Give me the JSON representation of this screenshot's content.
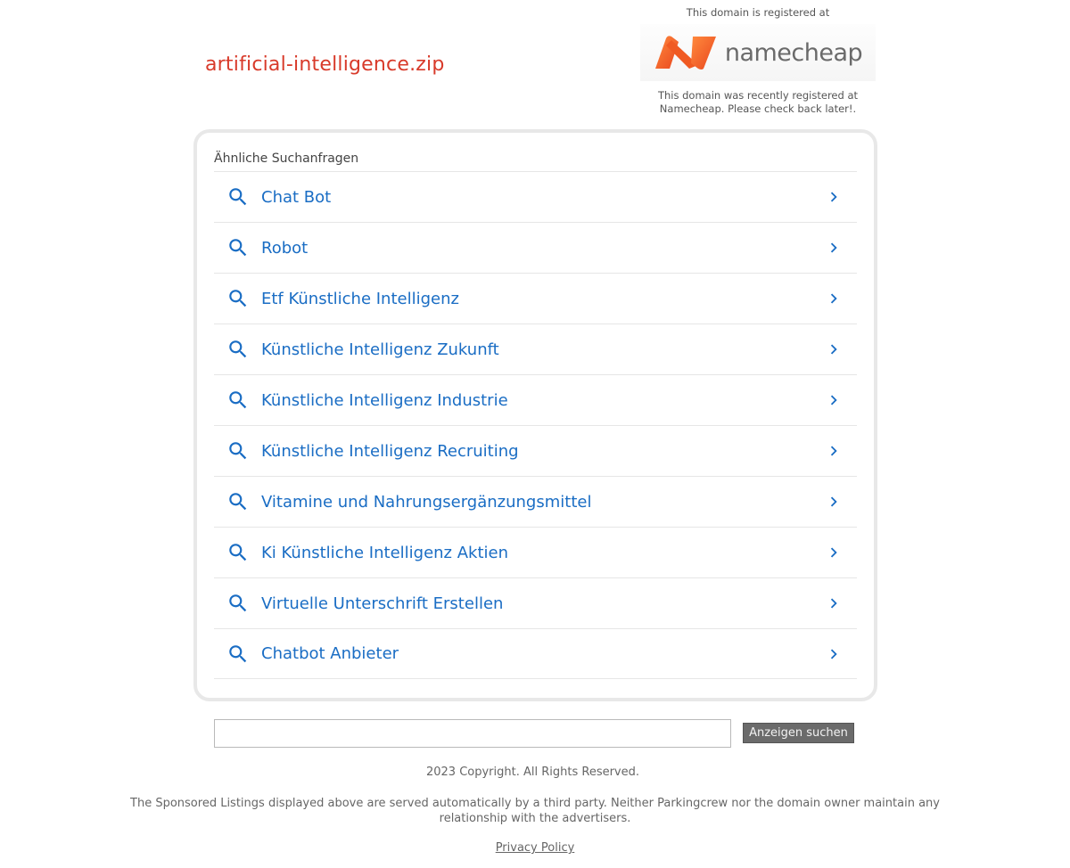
{
  "domain": "artificial-intelligence.zip",
  "registrar": {
    "top_text": "This domain is registered at",
    "logo_text": "namecheap",
    "note": "This domain was recently registered at Namecheap. Please check back later!."
  },
  "related": {
    "heading": "Ähnliche Suchanfragen",
    "items": [
      {
        "label": "Chat Bot"
      },
      {
        "label": "Robot"
      },
      {
        "label": "Etf Künstliche Intelligenz"
      },
      {
        "label": "Künstliche Intelligenz Zukunft"
      },
      {
        "label": "Künstliche Intelligenz Industrie"
      },
      {
        "label": "Künstliche Intelligenz Recruiting"
      },
      {
        "label": "Vitamine und Nahrungsergänzungsmittel"
      },
      {
        "label": "Ki Künstliche Intelligenz Aktien"
      },
      {
        "label": "Virtuelle Unterschrift Erstellen"
      },
      {
        "label": "Chatbot Anbieter"
      }
    ]
  },
  "search": {
    "value": "",
    "button_label": "Anzeigen suchen"
  },
  "footer": {
    "copyright": "2023 Copyright. All Rights Reserved.",
    "disclaimer": "The Sponsored Listings displayed above are served automatically by a third party. Neither Parkingcrew nor the domain owner maintain any relationship with the advertisers.",
    "privacy_label": "Privacy Policy"
  },
  "colors": {
    "domain_title": "#d83a2a",
    "link_blue": "#1a6dc4",
    "logo_orange": "#f26b1f"
  }
}
